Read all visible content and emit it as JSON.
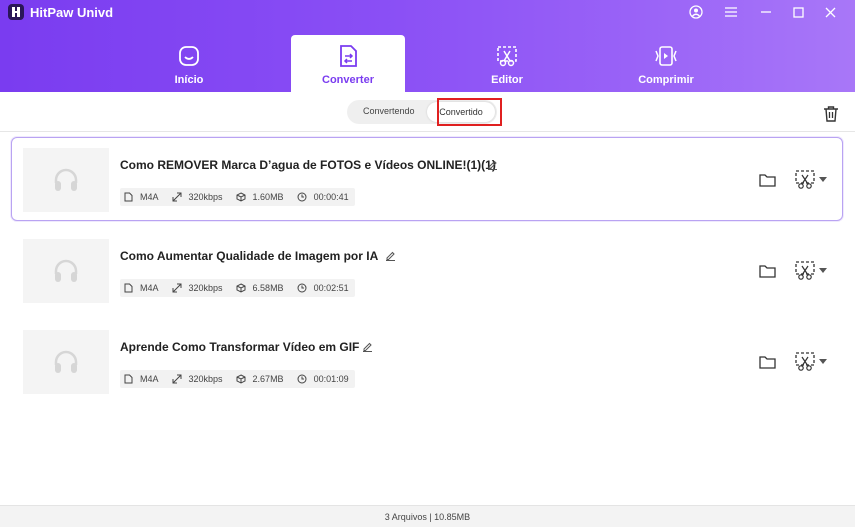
{
  "app": {
    "title": "HitPaw Univd"
  },
  "nav": {
    "tabs": [
      {
        "label": "Início",
        "icon": "home-icon"
      },
      {
        "label": "Converter",
        "icon": "convert-icon"
      },
      {
        "label": "Editor",
        "icon": "editor-icon"
      },
      {
        "label": "Comprimir",
        "icon": "compress-icon"
      }
    ],
    "active": "Converter"
  },
  "subbar": {
    "toggle": {
      "option1": "Convertendo",
      "option2": "Convertido",
      "selected": "Convertido"
    }
  },
  "files": [
    {
      "name": "Como REMOVER Marca D’agua de FOTOS e Vídeos ONLINE!(1)(1)",
      "format": "M4A",
      "bitrate": "320kbps",
      "size": "1.60MB",
      "duration": "00:00:41",
      "selected": true
    },
    {
      "name": "Como Aumentar Qualidade de Imagem por IA",
      "format": "M4A",
      "bitrate": "320kbps",
      "size": "6.58MB",
      "duration": "00:02:51",
      "selected": false
    },
    {
      "name": "Aprende Como Transformar Vídeo em GIF",
      "format": "M4A",
      "bitrate": "320kbps",
      "size": "2.67MB",
      "duration": "00:01:09",
      "selected": false
    }
  ],
  "footer": {
    "summary": "3 Arquivos | 10.85MB"
  },
  "colors": {
    "accent": "#7a3cf0",
    "highlight": "#e02020"
  }
}
